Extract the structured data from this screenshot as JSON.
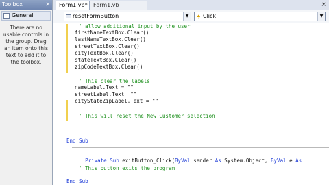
{
  "toolbox": {
    "title": "Toolbox",
    "pin_glyph": "✕",
    "group_label": "General",
    "group_expander": "−",
    "message": "There are no usable controls in the group. Drag an item onto this text to add it to the toolbox."
  },
  "tabs": [
    {
      "label": "Form1.vb*"
    },
    {
      "label": "Form1.vb [Design]*"
    }
  ],
  "tab_close": "×",
  "nav": {
    "object_combo": "resetFormButton",
    "event_combo": "Click",
    "drop_glyph": "▼"
  },
  "code": [
    {
      "text": "' allow additional input by the user",
      "type": "comment"
    },
    {
      "text": "firstNameTextBox.Clear()",
      "type": "code"
    },
    {
      "text": "lastNameTextBox.Clear()",
      "type": "code"
    },
    {
      "text": "streetTextBox.Clear()",
      "type": "code"
    },
    {
      "text": "cityTextBox.Clear()",
      "type": "code"
    },
    {
      "text": "stateTextBox.Clear()",
      "type": "code"
    },
    {
      "text": "zipCodeTextBox.Clear()",
      "type": "code"
    },
    {
      "text": "",
      "type": "code"
    },
    {
      "text": "' This clear the labels",
      "type": "comment"
    },
    {
      "text": "nameLabel.Text = \"\"",
      "type": "code"
    },
    {
      "text": "streetLabel.Text  \"\"",
      "type": "code"
    },
    {
      "text": "cityStateZipLabel.Text = \"\"",
      "type": "code"
    },
    {
      "text": "",
      "type": "code"
    },
    {
      "text": "' This will reset the New Customer selection",
      "type": "comment"
    },
    {
      "text": "End Sub",
      "type": "keyword"
    },
    {
      "text": "Private Sub exitButton_Click(ByVal sender As System.Object, ByVal e As",
      "type": "mixed"
    },
    {
      "text": "' This button exits the program",
      "type": "comment"
    },
    {
      "text": "End Sub",
      "type": "keyword"
    }
  ]
}
